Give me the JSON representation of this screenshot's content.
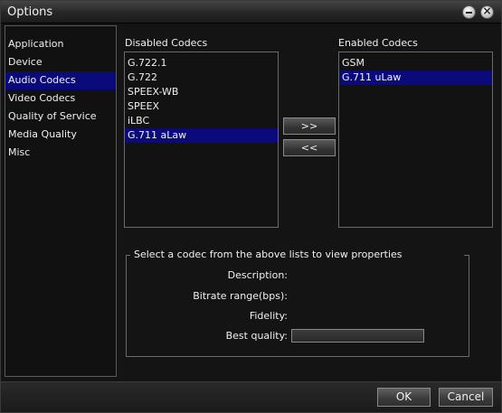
{
  "window": {
    "title": "Options"
  },
  "nav": {
    "items": [
      {
        "label": "Application",
        "selected": false
      },
      {
        "label": "Device",
        "selected": false
      },
      {
        "label": "Audio Codecs",
        "selected": true
      },
      {
        "label": "Video Codecs",
        "selected": false
      },
      {
        "label": "Quality of Service",
        "selected": false
      },
      {
        "label": "Media Quality",
        "selected": false
      },
      {
        "label": "Misc",
        "selected": false
      }
    ]
  },
  "disabled_codecs": {
    "label": "Disabled Codecs",
    "items": [
      {
        "label": "G.722.1",
        "selected": false
      },
      {
        "label": "G.722",
        "selected": false
      },
      {
        "label": "SPEEX-WB",
        "selected": false
      },
      {
        "label": "SPEEX",
        "selected": false
      },
      {
        "label": "iLBC",
        "selected": false
      },
      {
        "label": "G.711 aLaw",
        "selected": true
      }
    ]
  },
  "enabled_codecs": {
    "label": "Enabled Codecs",
    "items": [
      {
        "label": "GSM",
        "selected": false
      },
      {
        "label": "G.711 uLaw",
        "selected": true
      }
    ]
  },
  "move": {
    "add_label": ">>",
    "remove_label": "<<"
  },
  "properties": {
    "title": "Select a codec from the above lists to view properties",
    "description_label": "Description:",
    "bitrate_label": "Bitrate range(bps):",
    "fidelity_label": "Fidelity:",
    "best_quality_label": "Best quality:",
    "best_quality_fraction": 0
  },
  "footer": {
    "ok_label": "OK",
    "cancel_label": "Cancel"
  },
  "colors": {
    "selection": "#0a0a7a",
    "background": "#141414"
  },
  "icons": {
    "minimize": "minimize-icon",
    "close": "close-icon"
  }
}
